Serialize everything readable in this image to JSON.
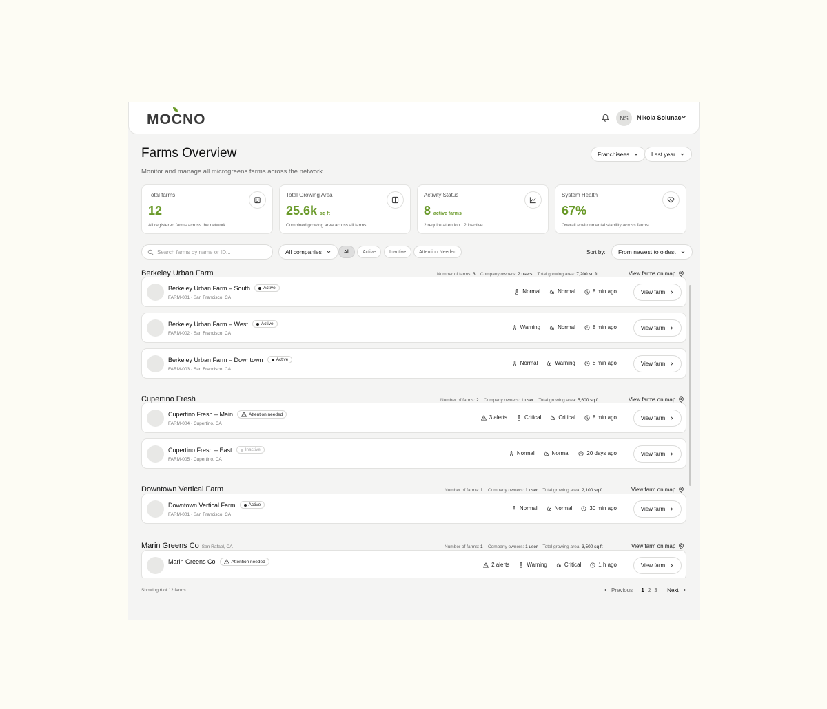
{
  "app": {
    "logo": "MOCNO"
  },
  "header": {
    "user_initials": "NS",
    "user_name": "Nikola Solunac"
  },
  "page": {
    "title": "Farms Overview",
    "subtitle": "Monitor and manage all microgreens farms across the network",
    "filter_franchisees": "Franchisees",
    "filter_period": "Last year"
  },
  "stats": [
    {
      "label": "Total farms",
      "value": "12",
      "unit": "",
      "desc": "All registered farms across the network",
      "icon": "building-icon"
    },
    {
      "label": "Total Growing Area",
      "value": "25.6k",
      "unit": "sq ft",
      "desc": "Combined growing area across all farms",
      "icon": "grid-icon"
    },
    {
      "label": "Activity Status",
      "value": "8",
      "unit": "active farms",
      "desc": "2 require attention · 2 inactive",
      "icon": "chart-icon"
    },
    {
      "label": "System Health",
      "value": "67%",
      "unit": "",
      "desc": "Overall environmental stability across farms",
      "icon": "heart-pulse-icon"
    }
  ],
  "toolbar": {
    "search_placeholder": "Search farms by name or ID...",
    "companies": "All companies",
    "filters": [
      "All",
      "Active",
      "Inactive",
      "Attention Needed"
    ],
    "sort_label": "Sort by:",
    "sort_value": "From newest to oldest"
  },
  "groups": [
    {
      "title": "Berkeley Urban Farm",
      "location": "",
      "farms_label": "Number of farms:",
      "farms": "3",
      "owners_label": "Company owners:",
      "owners": "2 users",
      "area_label": "Total growing area:",
      "area": "7,200 sq ft",
      "map_link": "View farms on map",
      "items": [
        {
          "name": "Berkeley Urban Farm – South",
          "status": "Active",
          "sub": "FARM-001 · San Francisco, CA",
          "alerts": "",
          "temp": "Normal",
          "humidity": "Normal",
          "time": "8 min ago"
        },
        {
          "name": "Berkeley Urban Farm – West",
          "status": "Active",
          "sub": "FARM-002 · San Francisco, CA",
          "alerts": "",
          "temp": "Warning",
          "humidity": "Normal",
          "time": "8 min ago"
        },
        {
          "name": "Berkeley Urban Farm – Downtown",
          "status": "Active",
          "sub": "FARM-003 · San Francisco, CA",
          "alerts": "",
          "temp": "Normal",
          "humidity": "Warning",
          "time": "8 min ago"
        }
      ]
    },
    {
      "title": "Cupertino Fresh",
      "location": "",
      "farms_label": "Number of farms:",
      "farms": "2",
      "owners_label": "Company owners:",
      "owners": "1 user",
      "area_label": "Total growing area:",
      "area": "5,600 sq ft",
      "map_link": "View farms on map",
      "items": [
        {
          "name": "Cupertino Fresh – Main",
          "status": "Attention needed",
          "sub": "FARM-004 · Cupertino, CA",
          "alerts": "3 alerts",
          "temp": "Critical",
          "humidity": "Critical",
          "time": "8 min ago"
        },
        {
          "name": "Cupertino Fresh – East",
          "status": "Inactive",
          "sub": "FARM-005 · Cupertino, CA",
          "alerts": "",
          "temp": "Normal",
          "humidity": "Normal",
          "time": "20 days ago"
        }
      ]
    },
    {
      "title": "Downtown Vertical Farm",
      "location": "",
      "farms_label": "Number of farms:",
      "farms": "1",
      "owners_label": "Company owners:",
      "owners": "1 user",
      "area_label": "Total growing area:",
      "area": "2,100 sq ft",
      "map_link": "View farm on map",
      "items": [
        {
          "name": "Downtown Vertical Farm",
          "status": "Active",
          "sub": "FARM-001 · San Francisco, CA",
          "alerts": "",
          "temp": "Normal",
          "humidity": "Normal",
          "time": "30 min ago"
        }
      ]
    },
    {
      "title": "Marin Greens Co",
      "location": "San Rafael, CA",
      "farms_label": "Number of farms:",
      "farms": "1",
      "owners_label": "Company owners:",
      "owners": "1 user",
      "area_label": "Total growing area:",
      "area": "3,500 sq ft",
      "map_link": "View farm on map",
      "items": [
        {
          "name": "Marin Greens Co",
          "status": "Attention needed",
          "sub": "",
          "alerts": "2 alerts",
          "temp": "Warning",
          "humidity": "Critical",
          "time": "1 h ago"
        }
      ]
    }
  ],
  "card_button": "View farm",
  "footer": {
    "showing": "Showing 6 of 12 farms",
    "prev": "Previous",
    "pages": [
      "1",
      "2",
      "3"
    ],
    "current_page": "1",
    "next": "Next"
  }
}
